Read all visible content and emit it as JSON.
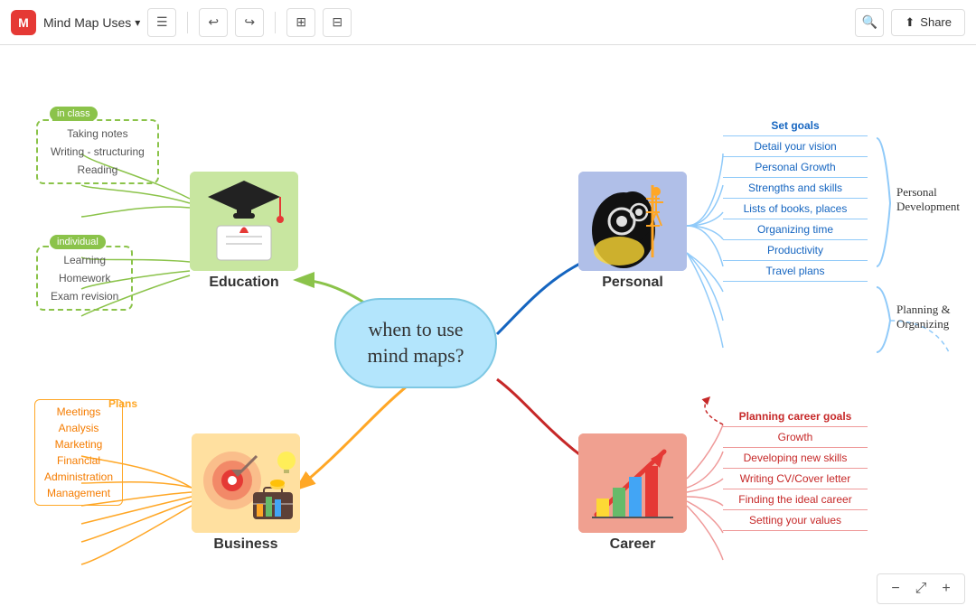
{
  "toolbar": {
    "logo": "M",
    "title": "Mind Map Uses",
    "undo_label": "←",
    "redo_label": "→",
    "search_label": "🔍",
    "share_label": "Share"
  },
  "center": {
    "text": "when to use\nmind maps?"
  },
  "education": {
    "label": "Education",
    "in_class_tag": "in class",
    "in_class_items": [
      "Taking notes",
      "Writing - structuring",
      "Reading"
    ],
    "individual_tag": "individual",
    "individual_items": [
      "Learning",
      "Homework",
      "Exam revision"
    ]
  },
  "business": {
    "label": "Business",
    "plans_tag": "Plans",
    "items": [
      "Meetings",
      "Analysis",
      "Marketing",
      "Financial",
      "Administration",
      "Management"
    ]
  },
  "personal": {
    "label": "Personal",
    "items": [
      "Set goals",
      "Detail your vision",
      "Personal Growth",
      "Strengths and skills",
      "Lists of books, places",
      "Organizing time",
      "Productivity",
      "Travel plans"
    ]
  },
  "career": {
    "label": "Career",
    "items": [
      "Planning career goals",
      "Growth",
      "Developing new skills",
      "Writing CV/Cover letter",
      "Finding the ideal career",
      "Setting  your values"
    ]
  },
  "side_labels": {
    "personal_dev": "Personal\nDevelopment",
    "planning": "Planning &\nOrganizing"
  },
  "zoom": {
    "minus": "−",
    "fit": "⤢",
    "plus": "+"
  }
}
